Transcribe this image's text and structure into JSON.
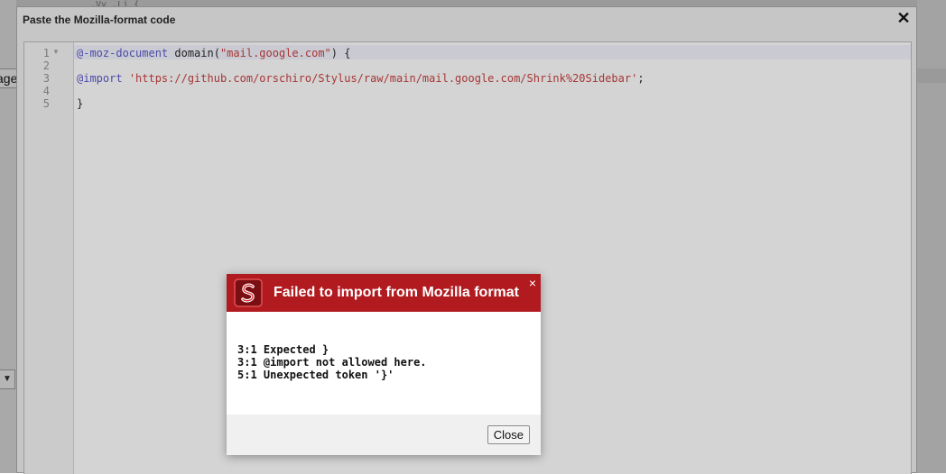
{
  "background": {
    "left_snippet": "age",
    "top_code": ".Vy .Li {"
  },
  "dialog": {
    "title": "Paste the Mozilla-format code",
    "close_glyph": "✕"
  },
  "editor": {
    "line_numbers": [
      "1",
      "2",
      "3",
      "4",
      "5"
    ],
    "lines": {
      "l1_kw": "@-moz-document",
      "l1_plain": " domain(",
      "l1_str": "\"mail.google.com\"",
      "l1_end": ") {",
      "l3_kw": "@import",
      "l3_str": "'https://github.com/orschiro/Stylus/raw/main/mail.google.com/Shrink%20Sidebar'",
      "l3_end": ";",
      "l5": "}"
    }
  },
  "alert": {
    "title": "Failed to import from Mozilla format",
    "close_glyph": "×",
    "errors": [
      "3:1 Expected }",
      "3:1 @import not allowed here.",
      "5:1 Unexpected token '}'"
    ],
    "button_label": "Close"
  },
  "colors": {
    "alert_header": "#b11b20",
    "keyword": "#4b4baa",
    "string": "#a73535"
  }
}
